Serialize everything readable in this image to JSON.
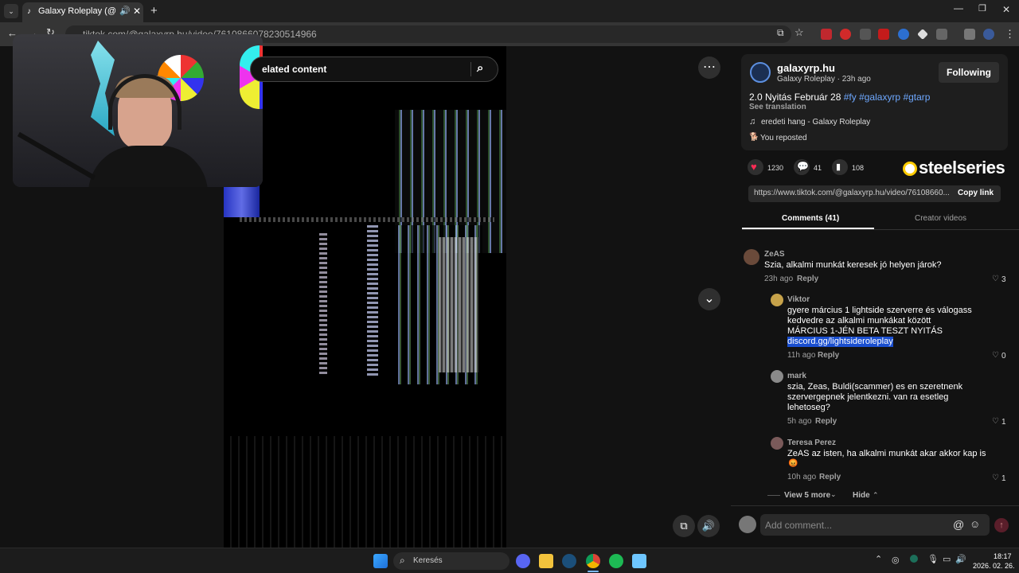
{
  "browser": {
    "tab_title": "Galaxy Roleplay (@galaxyrp",
    "url_text": "tiktok.com/@galaxyrp.hu/video/7610866078230514966"
  },
  "search": {
    "text": "elated content"
  },
  "post": {
    "username": "galaxyrp.hu",
    "subline": "Galaxy Roleplay · 23h ago",
    "follow_label": "Following",
    "caption_text": "2.0 Nyitás Február 28",
    "hashtags": "#fy #galaxyrp #gtarp",
    "see_translation": "See translation",
    "sound": "eredeti hang - Galaxy Roleplay",
    "reposted": "You reposted",
    "like_count": "1230",
    "comment_count": "41",
    "bookmark_count": "108",
    "share_url": "https://www.tiktok.com/@galaxyrp.hu/video/76108660...",
    "copy_link": "Copy link",
    "watermark": "steelseries"
  },
  "tabs": {
    "comments": "Comments (41)",
    "creator": "Creator videos"
  },
  "comments": [
    {
      "name": "ZeAS",
      "text": "Szia, alkalmi munkát keresek jó helyen járok?",
      "time": "23h ago",
      "reply": "Reply",
      "likes": "3"
    },
    {
      "name": "Viktor",
      "line1": "gyere március 1 lightside szerverre és válogass",
      "line2": "kedvedre az alkalmi munkákat között",
      "line3": "MÁRCIUS 1-JÉN BETA TESZT NYITÁS",
      "line4": "discord.gg/lightsideroleplay",
      "time": "11h ago",
      "reply": "Reply",
      "likes": "0"
    },
    {
      "name": "mark",
      "line1": "szia, Zeas, Buldi(scammer) es en szeretnenk",
      "line2": "szervergepnek jelentkezni. van ra esetleg",
      "line3": "lehetoseg?",
      "time": "5h ago",
      "reply": "Reply",
      "likes": "1"
    },
    {
      "name": "Teresa Perez",
      "line1": "ZeAS az isten, ha alkalmi munkát akar akkor kap is",
      "time": "10h ago",
      "reply": "Reply",
      "likes": "1"
    }
  ],
  "thread": {
    "view_more": "View 5 more",
    "hide": "Hide"
  },
  "composer": {
    "placeholder": "Add comment...",
    "at": "@"
  },
  "taskbar": {
    "search": "Keresés",
    "time": "18:17",
    "date": "2026. 02. 26."
  },
  "colors": {
    "accent": "#fe2c55",
    "link": "#6ea8ff",
    "highlight": "#1a4fd0"
  }
}
